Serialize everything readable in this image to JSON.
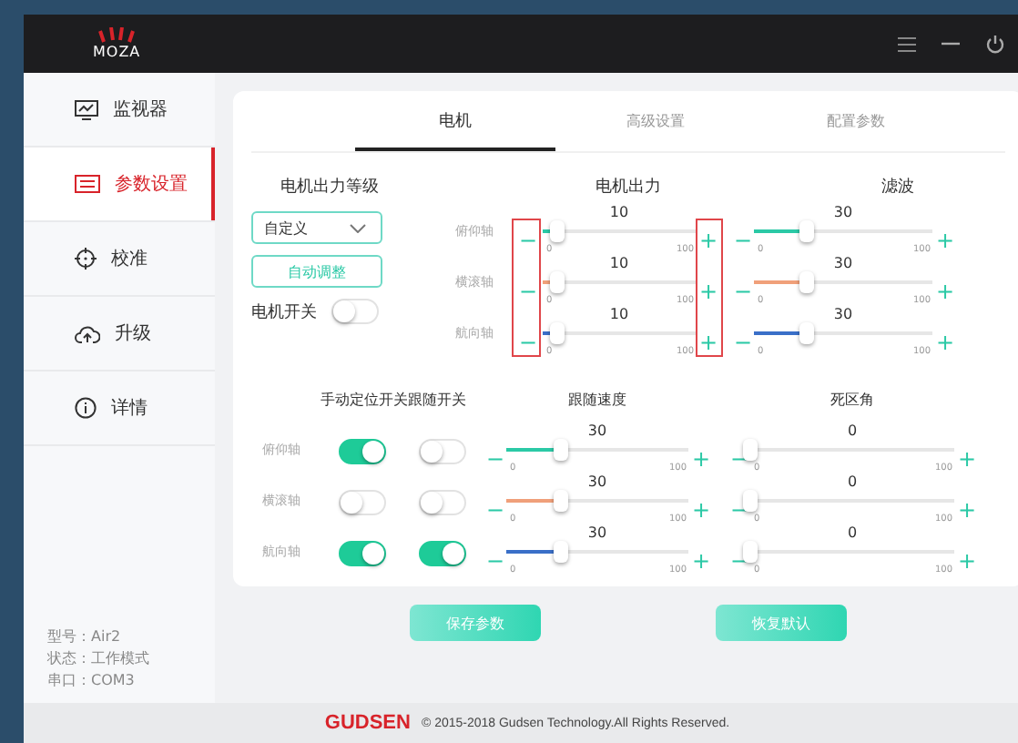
{
  "app": {
    "logo": "MOZA"
  },
  "sidebar": {
    "items": [
      {
        "label": "监视器",
        "selected": false
      },
      {
        "label": "参数设置",
        "selected": true
      },
      {
        "label": "校准",
        "selected": false
      },
      {
        "label": "升级",
        "selected": false
      },
      {
        "label": "详情",
        "selected": false
      }
    ]
  },
  "device_info": [
    "型号：Air2",
    "状态：工作模式",
    "串口：COM3"
  ],
  "tabs": [
    {
      "label": "电机",
      "selected": true
    },
    {
      "label": "高级设置",
      "selected": false
    },
    {
      "label": "配置参数",
      "selected": false
    }
  ],
  "slider_buttons": {
    "minus": "−",
    "plus": "+"
  },
  "motor": {
    "level_title": "电机出力等级",
    "preset": "自定义",
    "auto_button": "自动调整",
    "switch_label": "电机开关",
    "switch_on": false,
    "output_title": "电机出力",
    "filter_title": "滤波",
    "axes": [
      {
        "name": "俯仰轴",
        "color": "#2bc9a6",
        "output": {
          "reading": "10",
          "level": 0.1,
          "min": "0",
          "max": "100"
        },
        "filter": {
          "reading": "30",
          "level": 0.3,
          "min": "0",
          "max": "100"
        }
      },
      {
        "name": "横滚轴",
        "color": "#f0a07a",
        "output": {
          "reading": "10",
          "level": 0.1,
          "min": "0",
          "max": "100"
        },
        "filter": {
          "reading": "30",
          "level": 0.3,
          "min": "0",
          "max": "100"
        }
      },
      {
        "name": "航向轴",
        "color": "#3a6fc8",
        "output": {
          "reading": "10",
          "level": 0.1,
          "min": "0",
          "max": "100"
        },
        "filter": {
          "reading": "30",
          "level": 0.3,
          "min": "0",
          "max": "100"
        }
      }
    ]
  },
  "follow": {
    "manual_title": "手动定位开关",
    "follow_title": "跟随开关",
    "speed_title": "跟随速度",
    "deadzone_title": "死区角",
    "axes": [
      {
        "name": "俯仰轴",
        "color": "#2bc9a6",
        "manual_on": true,
        "follow_on": false,
        "speed": {
          "reading": "30",
          "level": 0.3,
          "min": "0",
          "max": "100"
        },
        "deadzone": {
          "reading": "0",
          "level": 0,
          "min": "0",
          "max": "100"
        }
      },
      {
        "name": "横滚轴",
        "color": "#f0a07a",
        "manual_on": false,
        "follow_on": false,
        "speed": {
          "reading": "30",
          "level": 0.3,
          "min": "0",
          "max": "100"
        },
        "deadzone": {
          "reading": "0",
          "level": 0,
          "min": "0",
          "max": "100"
        }
      },
      {
        "name": "航向轴",
        "color": "#3a6fc8",
        "manual_on": true,
        "follow_on": true,
        "speed": {
          "reading": "30",
          "level": 0.3,
          "min": "0",
          "max": "100"
        },
        "deadzone": {
          "reading": "0",
          "level": 0,
          "min": "0",
          "max": "100"
        }
      }
    ]
  },
  "buttons": [
    "保存参数",
    "恢复默认"
  ],
  "footer": {
    "brand": "GUDSEN",
    "copyright": "© 2015-2018 Gudsen Technology.All Rights Reserved."
  }
}
